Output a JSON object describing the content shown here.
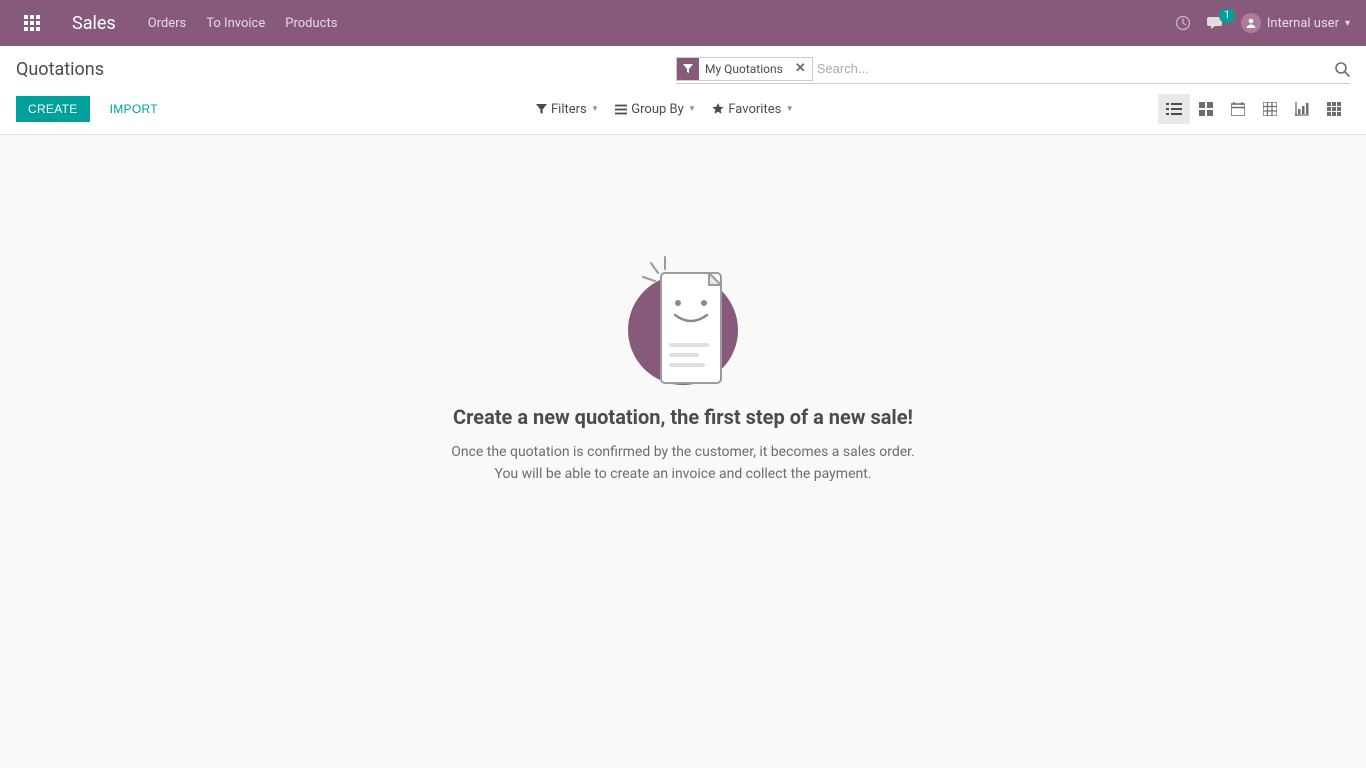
{
  "topnav": {
    "brand": "Sales",
    "menu": [
      "Orders",
      "To Invoice",
      "Products"
    ],
    "conversations_badge": "1",
    "user_name": "Internal user"
  },
  "control_panel": {
    "breadcrumb": "Quotations",
    "create_label": "Create",
    "import_label": "Import",
    "active_filter": "My Quotations",
    "search_placeholder": "Search...",
    "filters_label": "Filters",
    "groupby_label": "Group By",
    "favorites_label": "Favorites"
  },
  "empty_state": {
    "title": "Create a new quotation, the first step of a new sale!",
    "line1": "Once the quotation is confirmed by the customer, it becomes a sales order.",
    "line2": "You will be able to create an invoice and collect the payment."
  }
}
